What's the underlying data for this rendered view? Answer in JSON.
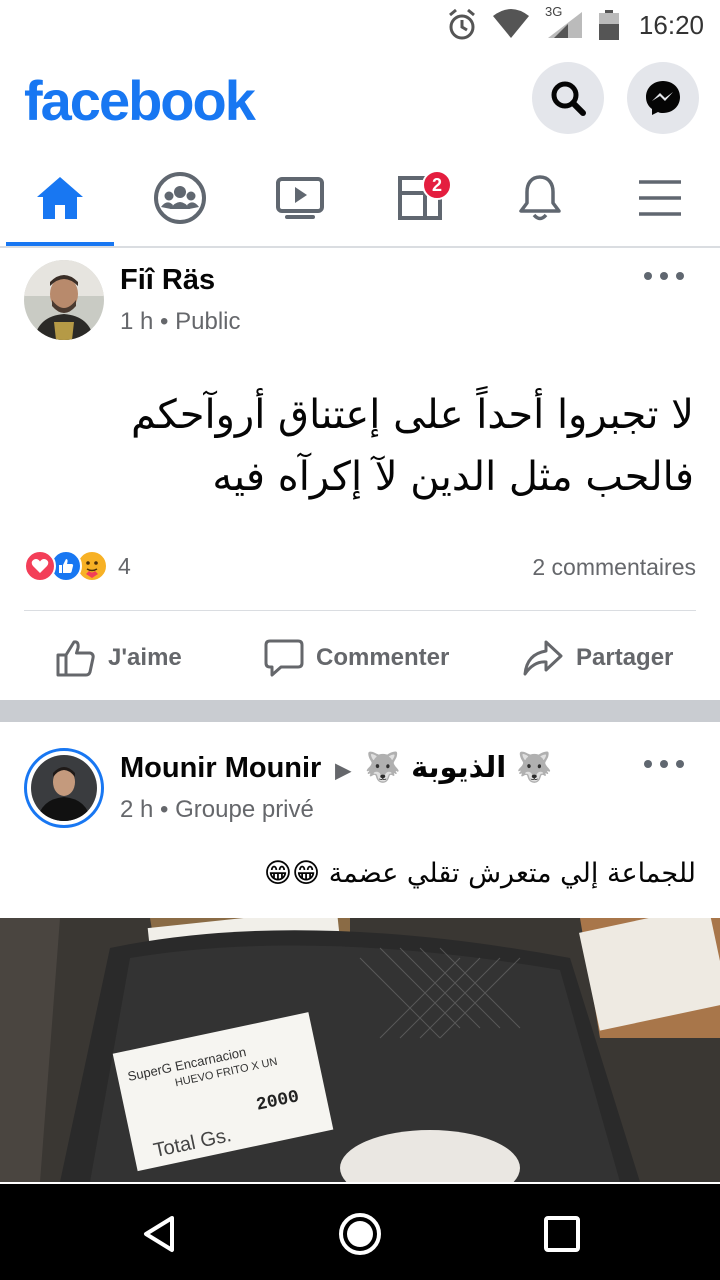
{
  "status_bar": {
    "time": "16:20",
    "network": "3G"
  },
  "app": {
    "logo": "facebook"
  },
  "nav": {
    "tabs": [
      {
        "name": "home",
        "icon": "home-icon",
        "active": true
      },
      {
        "name": "groups",
        "icon": "groups-icon"
      },
      {
        "name": "watch",
        "icon": "video-icon"
      },
      {
        "name": "pages",
        "icon": "pages-icon",
        "badge": "2"
      },
      {
        "name": "notifications",
        "icon": "bell-icon"
      },
      {
        "name": "menu",
        "icon": "menu-icon"
      }
    ]
  },
  "posts": [
    {
      "author": "Fiî Räs",
      "time": "1 h",
      "audience": "Public",
      "text_line1": "لا تجبروا أحداً على إعتناق أروآحكم",
      "text_line2": "فالحب مثل الدين لآ إكرآه فيه",
      "reaction_count": "4",
      "comments": "2 commentaires",
      "actions": {
        "like": "J'aime",
        "comment": "Commenter",
        "share": "Partager"
      }
    },
    {
      "author": "Mounir Mounir",
      "group": "🐺 الذيوبة 🐺",
      "time": "2 h",
      "audience": "Groupe privé",
      "text": "للجماعة  إلي متعرش تقلي عضمة 😁😁",
      "image_labels": {
        "price_label_store": "SuperG Encarnacion",
        "price_label_item": "HUEVO FRITO X UN",
        "price_label_price": "2000",
        "price_label_total": "Total Gs."
      }
    }
  ],
  "colors": {
    "brand": "#1877f2",
    "badge": "#e41e3f",
    "love": "#f33e58",
    "like": "#1877f2",
    "care": "#f7b125"
  }
}
